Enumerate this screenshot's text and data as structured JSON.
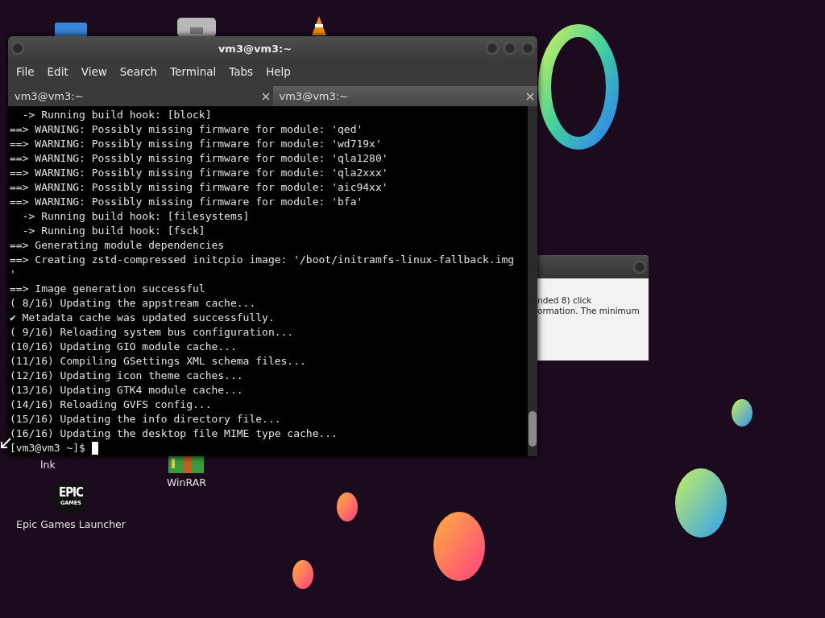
{
  "desktop_icons": [
    {
      "kind": "folder"
    },
    {
      "kind": "document"
    },
    {
      "kind": "cone"
    },
    {
      "kind": "shortcut",
      "label": "lnk"
    },
    {
      "kind": "archive",
      "label": "WinRAR"
    },
    {
      "kind": "epic",
      "label": "Epic Games Launcher",
      "logo_lines": [
        "EPIC",
        "GAMES"
      ]
    }
  ],
  "background_dialog": {
    "lines": [
      "nded 8) click",
      "ormation. The minimum"
    ]
  },
  "window": {
    "title": "vm3@vm3:~"
  },
  "menu": [
    "File",
    "Edit",
    "View",
    "Search",
    "Terminal",
    "Tabs",
    "Help"
  ],
  "tabs": [
    {
      "label": "vm3@vm3:~",
      "selected": false
    },
    {
      "label": "vm3@vm3:~",
      "selected": true
    }
  ],
  "terminal": {
    "lines": [
      "  -> Running build hook: [block]",
      "==> WARNING: Possibly missing firmware for module: 'qed'",
      "==> WARNING: Possibly missing firmware for module: 'wd719x'",
      "==> WARNING: Possibly missing firmware for module: 'qla1280'",
      "==> WARNING: Possibly missing firmware for module: 'qla2xxx'",
      "==> WARNING: Possibly missing firmware for module: 'aic94xx'",
      "==> WARNING: Possibly missing firmware for module: 'bfa'",
      "  -> Running build hook: [filesystems]",
      "  -> Running build hook: [fsck]",
      "==> Generating module dependencies",
      "==> Creating zstd-compressed initcpio image: '/boot/initramfs-linux-fallback.img",
      "'",
      "==> Image generation successful",
      "( 8/16) Updating the appstream cache...",
      "✔ Metadata cache was updated successfully.",
      "( 9/16) Reloading system bus configuration...",
      "(10/16) Updating GIO module cache...",
      "(11/16) Compiling GSettings XML schema files...",
      "(12/16) Updating icon theme caches...",
      "(13/16) Updating GTK4 module cache...",
      "(14/16) Reloading GVFS config...",
      "(15/16) Updating the info directory file...",
      "(16/16) Updating the desktop file MIME type cache..."
    ],
    "prompt": "[vm3@vm3 ~]$ "
  }
}
